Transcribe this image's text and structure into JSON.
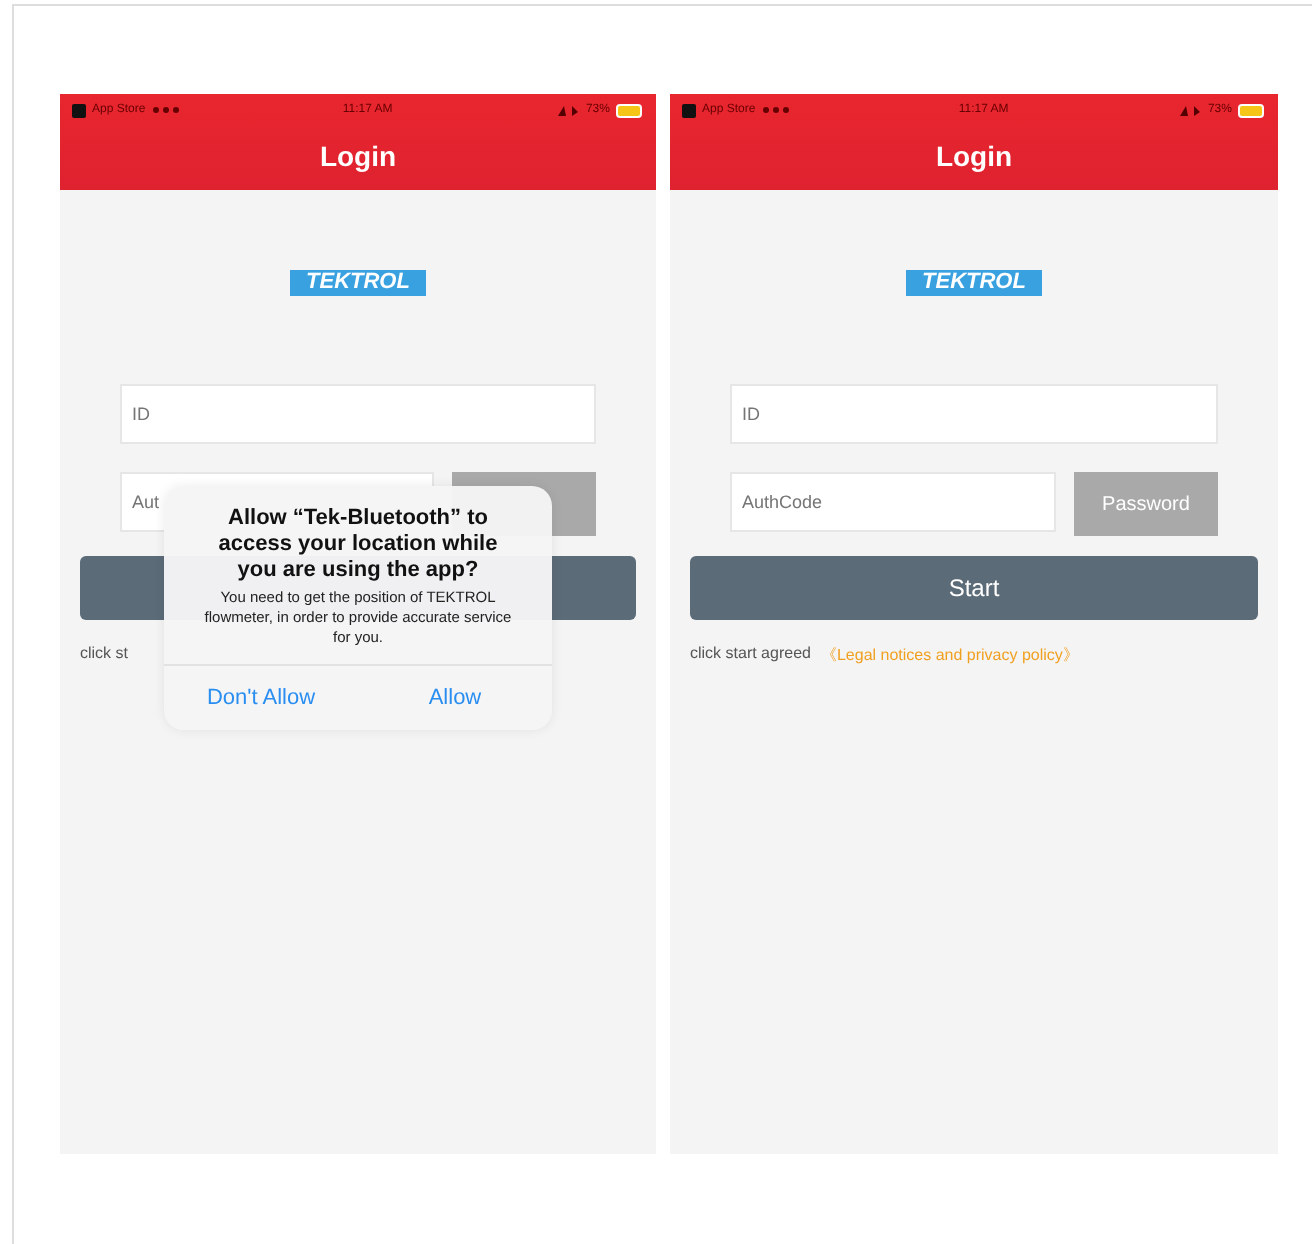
{
  "phones": [
    {
      "status_bar": {
        "carrier": "App Store",
        "time": "11:17 AM",
        "battery": "73%"
      },
      "title": "Login",
      "logo": "TEKTROL",
      "id_placeholder": "ID",
      "authcode_placeholder": "Aut",
      "agreement": "click st",
      "dialog": {
        "title": "Allow “Tek-Bluetooth” to access your location while you are using the app?",
        "message": "You need to get the position of TEKTROL flowmeter, in order to provide accurate service for you.",
        "buttons": [
          "Don't Allow",
          "Allow"
        ]
      }
    },
    {
      "status_bar": {
        "carrier": "App Store",
        "time": "11:17 AM",
        "battery": "73%"
      },
      "title": "Login",
      "logo": "TEKTROL",
      "id_placeholder": "ID",
      "authcode_placeholder": "AuthCode",
      "password_button": "Password",
      "start_button": "Start",
      "agreement": "click start agreed",
      "policy_link": "《Legal notices and privacy policy》"
    }
  ]
}
